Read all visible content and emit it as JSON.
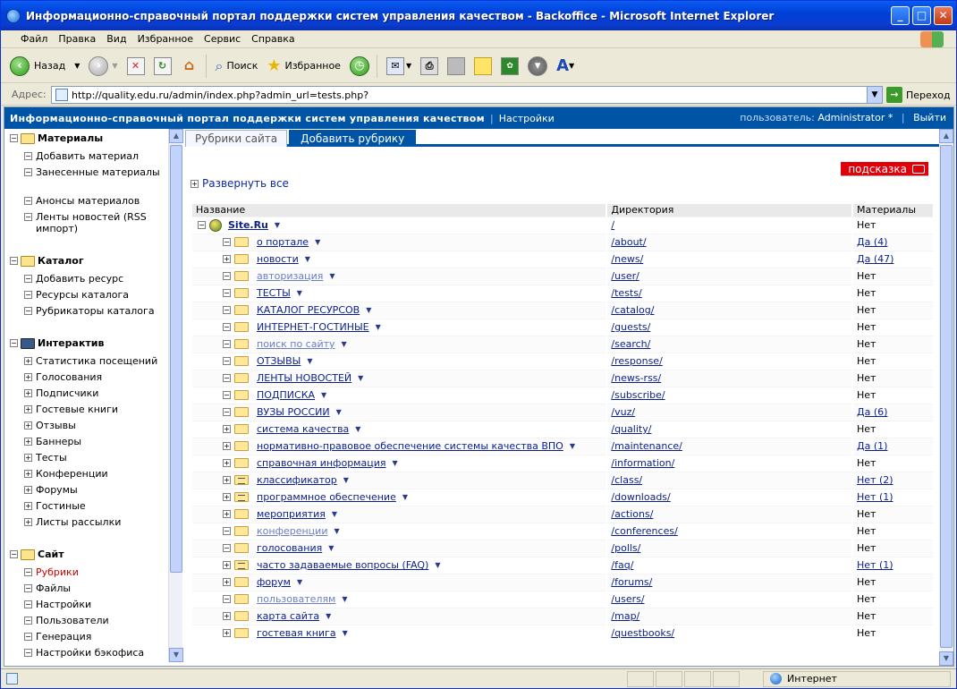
{
  "window": {
    "title": "Информационно-справочный портал поддержки систем управления качеством - Backoffice - Microsoft Internet Explorer"
  },
  "menu": [
    "Файл",
    "Правка",
    "Вид",
    "Избранное",
    "Сервис",
    "Справка"
  ],
  "toolbar": {
    "back": "Назад",
    "search": "Поиск",
    "favorites": "Избранное"
  },
  "address": {
    "label": "Адрес:",
    "url": "http://quality.edu.ru/admin/index.php?admin_url=tests.php?",
    "go": "Переход"
  },
  "header": {
    "title": "Информационно-справочный портал поддержки систем управления качеством",
    "settings": "Настройки",
    "user_label": "пользователь:",
    "user": "Administrator *",
    "logout": "Выйти"
  },
  "sidebar": {
    "groups": [
      {
        "title": "Материалы",
        "items": [
          "Добавить материал",
          "Занесенные материалы",
          "Анонсы материалов",
          "Ленты новостей (RSS импорт)"
        ]
      },
      {
        "title": "Каталог",
        "items": [
          "Добавить ресурс",
          "Ресурсы каталога",
          "Рубрикаторы каталога"
        ]
      },
      {
        "title": "Интерактив",
        "items": [
          "Статистика посещений",
          "Голосования",
          "Подписчики",
          "Гостевые книги",
          "Отзывы",
          "Баннеры",
          "Тесты",
          "Конференции",
          "Форумы",
          "Гостиные",
          "Листы рассылки"
        ]
      },
      {
        "title": "Сайт",
        "items": [
          "Рубрики",
          "Файлы",
          "Настройки",
          "Пользователи",
          "Генерация",
          "Настройки бэкофиса"
        ]
      }
    ]
  },
  "tabs": [
    "Рубрики сайта",
    "Добавить рубрику"
  ],
  "hint": "подсказка",
  "expand_all": "Развернуть все",
  "table": {
    "headers": [
      "Название",
      "Директория",
      "Материалы"
    ],
    "root": {
      "name": "Site.Ru",
      "dir": "/",
      "mat": "Нет"
    },
    "rows": [
      {
        "name": "о портале",
        "dir": "/about/",
        "mat": "Да (4)"
      },
      {
        "name": "новости",
        "dir": "/news/",
        "mat": "Да (47)"
      },
      {
        "name": "авторизация",
        "dir": "/user/",
        "mat": "Нет"
      },
      {
        "name": "ТЕСТЫ",
        "dir": "/tests/",
        "mat": "Нет"
      },
      {
        "name": "КАТАЛОГ РЕСУРСОВ",
        "dir": "/catalog/",
        "mat": "Нет"
      },
      {
        "name": "ИНТЕРНЕТ-ГОСТИНЫЕ",
        "dir": "/guests/",
        "mat": "Нет"
      },
      {
        "name": "поиск по сайту",
        "dir": "/search/",
        "mat": "Нет"
      },
      {
        "name": "ОТЗЫВЫ",
        "dir": "/response/",
        "mat": "Нет"
      },
      {
        "name": "ЛЕНТЫ НОВОСТЕЙ",
        "dir": "/news-rss/",
        "mat": "Нет"
      },
      {
        "name": "ПОДПИСКА",
        "dir": "/subscribe/",
        "mat": "Нет"
      },
      {
        "name": "ВУЗЫ РОССИИ",
        "dir": "/vuz/",
        "mat": "Да (6)"
      },
      {
        "name": "система качества",
        "dir": "/quality/",
        "mat": "Нет"
      },
      {
        "name": "нормативно-правовое обеспечение системы качества ВПО",
        "dir": "/maintenance/",
        "mat": "Да (1)"
      },
      {
        "name": "справочная информация",
        "dir": "/information/",
        "mat": "Нет"
      },
      {
        "name": "классификатор",
        "dir": "/class/",
        "mat": "Нет (2)"
      },
      {
        "name": "программное обеспечение",
        "dir": "/downloads/",
        "mat": "Нет (1)"
      },
      {
        "name": "мероприятия",
        "dir": "/actions/",
        "mat": "Нет"
      },
      {
        "name": "конференции",
        "dir": "/conferences/",
        "mat": "Нет"
      },
      {
        "name": "голосования",
        "dir": "/polls/",
        "mat": "Нет"
      },
      {
        "name": "часто задаваемые вопросы (FAQ)",
        "dir": "/faq/",
        "mat": "Нет (1)"
      },
      {
        "name": "форум",
        "dir": "/forums/",
        "mat": "Нет"
      },
      {
        "name": "пользователям",
        "dir": "/users/",
        "mat": "Нет"
      },
      {
        "name": "карта сайта",
        "dir": "/map/",
        "mat": "Нет"
      },
      {
        "name": "гостевая книга",
        "dir": "/questbooks/",
        "mat": "Нет"
      }
    ]
  },
  "status": {
    "zone": "Интернет"
  }
}
